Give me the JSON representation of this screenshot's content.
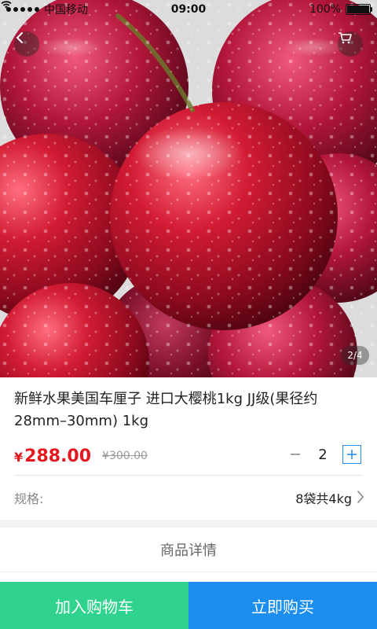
{
  "statusbar": {
    "carrier": "中国移动",
    "time": "09:00",
    "battery": "100%"
  },
  "gallery": {
    "indicator": "2/4"
  },
  "product": {
    "title": "新鲜水果美国车厘子 进口大樱桃1kg JJ级(果径约28mm–30mm) 1kg",
    "currency": "¥",
    "price": "288.00",
    "original_price": "¥300.00",
    "quantity": "2",
    "spec_label": "规格:",
    "spec_value": "8袋共4kg"
  },
  "tabs": {
    "detail": "商品详情"
  },
  "actions": {
    "add_to_cart": "加入购物车",
    "buy_now": "立即购买"
  },
  "colors": {
    "price": "#e4191f",
    "add_to_cart_bg": "#2fd38e",
    "buy_now_bg": "#1c8ef0",
    "accent": "#2a8df0"
  },
  "icons": {
    "back": "chevron-left-icon",
    "cart": "cart-icon",
    "plus": "plus-icon",
    "minus": "minus-icon",
    "chevron": "chevron-right-icon"
  }
}
